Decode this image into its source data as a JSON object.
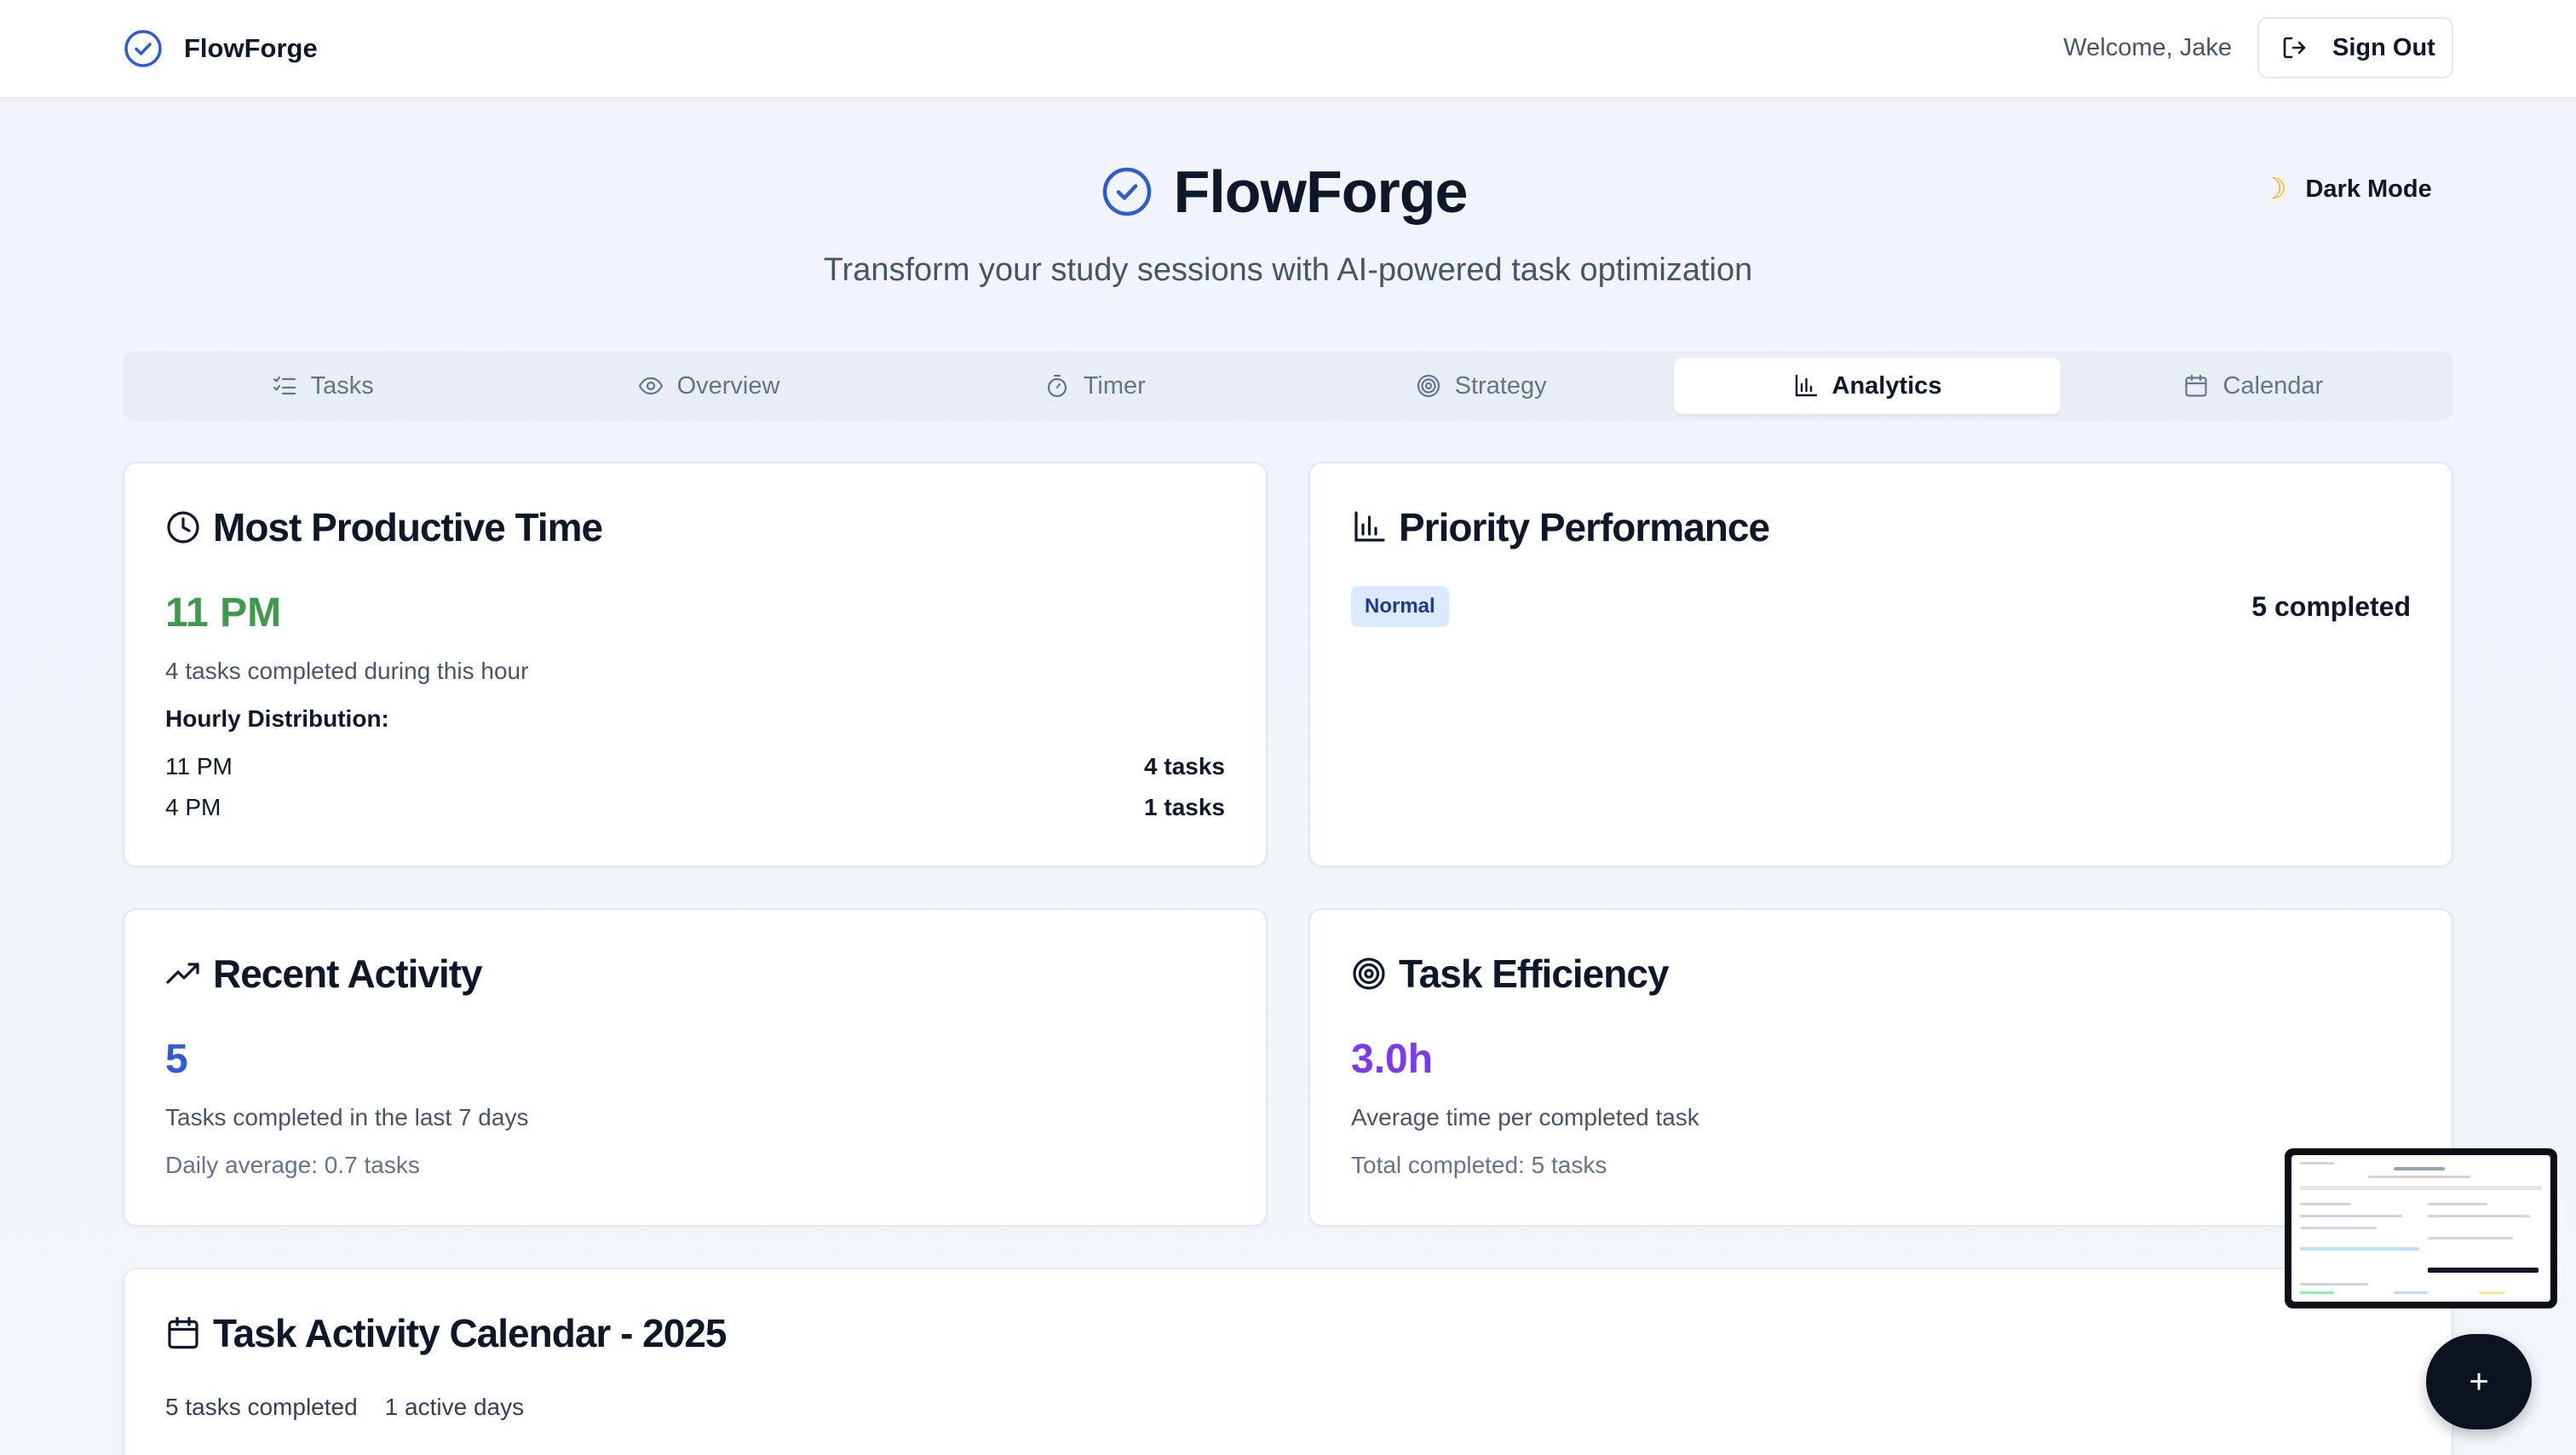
{
  "app": {
    "name": "FlowForge"
  },
  "header": {
    "welcome": "Welcome, Jake",
    "sign_out": "Sign Out"
  },
  "hero": {
    "title": "FlowForge",
    "subtitle": "Transform your study sessions with AI-powered task optimization",
    "dark_mode": "Dark Mode",
    "dark_mode_icon": "moon-icon"
  },
  "tabs": [
    {
      "label": "Tasks",
      "icon": "list-checks-icon"
    },
    {
      "label": "Overview",
      "icon": "eye-icon"
    },
    {
      "label": "Timer",
      "icon": "stopwatch-icon"
    },
    {
      "label": "Strategy",
      "icon": "target-icon"
    },
    {
      "label": "Analytics",
      "icon": "bar-chart-icon",
      "active": true
    },
    {
      "label": "Calendar",
      "icon": "calendar-icon"
    }
  ],
  "productive": {
    "title": "Most Productive Time",
    "value": "11 PM",
    "desc": "4 tasks completed during this hour",
    "dist_title": "Hourly Distribution:",
    "rows": [
      {
        "hour": "11 PM",
        "count": "4 tasks"
      },
      {
        "hour": "4 PM",
        "count": "1 tasks"
      }
    ]
  },
  "priority": {
    "title": "Priority Performance",
    "badge": "Normal",
    "completed": "5 completed"
  },
  "recent": {
    "title": "Recent Activity",
    "value": "5",
    "desc": "Tasks completed in the last 7 days",
    "sub": "Daily average: 0.7 tasks"
  },
  "efficiency": {
    "title": "Task Efficiency",
    "value": "3.0h",
    "desc": "Average time per completed task",
    "sub": "Total completed: 5 tasks"
  },
  "calendar_card": {
    "title": "Task Activity Calendar - 2025",
    "completed": "5 tasks completed",
    "active": "1 active days"
  },
  "fab": {
    "label": "+"
  },
  "colors": {
    "green": "#3f9a4b",
    "blue": "#2f5bd3",
    "purple": "#7c3aed",
    "brand": "#2f5bd3"
  }
}
